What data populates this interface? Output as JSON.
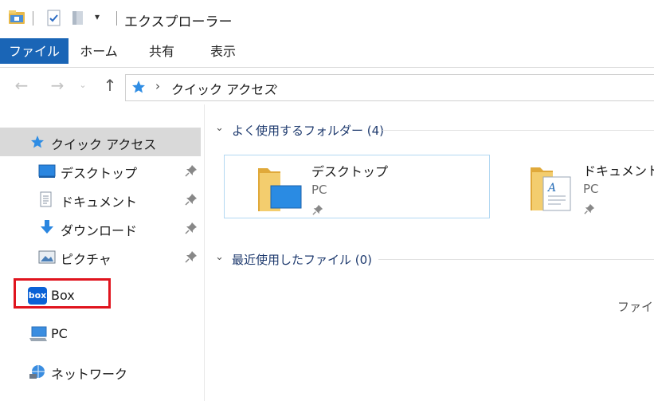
{
  "window": {
    "title": "エクスプローラー"
  },
  "ribbon": {
    "tabs": [
      "ファイル",
      "ホーム",
      "共有",
      "表示"
    ]
  },
  "address": {
    "crumb": "クイック アクセス"
  },
  "nav": {
    "items": [
      {
        "label": "クイック アクセス",
        "icon": "star-icon",
        "selected": true
      },
      {
        "label": "デスクトップ",
        "icon": "desktop-icon",
        "pinned": true
      },
      {
        "label": "ドキュメント",
        "icon": "document-icon",
        "pinned": true
      },
      {
        "label": "ダウンロード",
        "icon": "download-icon",
        "pinned": true
      },
      {
        "label": "ピクチャ",
        "icon": "pictures-icon",
        "pinned": true
      },
      {
        "label": "Box",
        "icon": "box-icon"
      },
      {
        "label": "PC",
        "icon": "pc-icon"
      },
      {
        "label": "ネットワーク",
        "icon": "network-icon"
      }
    ],
    "box_logo_text": "box"
  },
  "content": {
    "frequent_header": "よく使用するフォルダー (4)",
    "recent_header": "最近使用したファイル (0)",
    "tiles": [
      {
        "name": "デスクトップ",
        "location": "PC"
      },
      {
        "name": "ドキュメント",
        "location": "PC"
      }
    ],
    "partial_text": "ファイル"
  },
  "colors": {
    "file_tab": "#1a65b6",
    "highlight_box": "#e0141e",
    "selected_bg": "#d9d9d9"
  }
}
